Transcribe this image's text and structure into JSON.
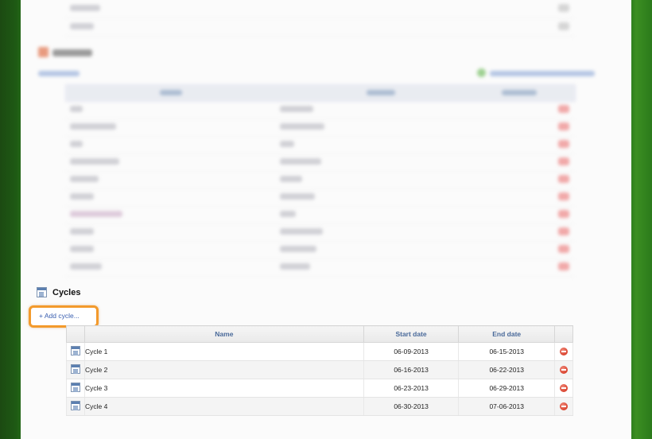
{
  "cycles_section": {
    "title": "Cycles",
    "add_link": "+ Add cycle..."
  },
  "cycles_table": {
    "headers": {
      "name": "Name",
      "start": "Start date",
      "end": "End date"
    },
    "rows": [
      {
        "name": "Cycle 1",
        "start": "06-09-2013",
        "end": "06-15-2013"
      },
      {
        "name": "Cycle 2",
        "start": "06-16-2013",
        "end": "06-22-2013"
      },
      {
        "name": "Cycle 3",
        "start": "06-23-2013",
        "end": "06-29-2013"
      },
      {
        "name": "Cycle 4",
        "start": "06-30-2013",
        "end": "07-06-2013"
      }
    ]
  },
  "colors": {
    "highlight": "#f39a2c",
    "link": "#3a5fb0",
    "header_text": "#4a6a9a",
    "delete": "#d9422e",
    "background_green": "#2c7a1c"
  },
  "icons": {
    "section": "calendar-icon",
    "row": "calendar-icon",
    "delete": "remove-icon"
  }
}
